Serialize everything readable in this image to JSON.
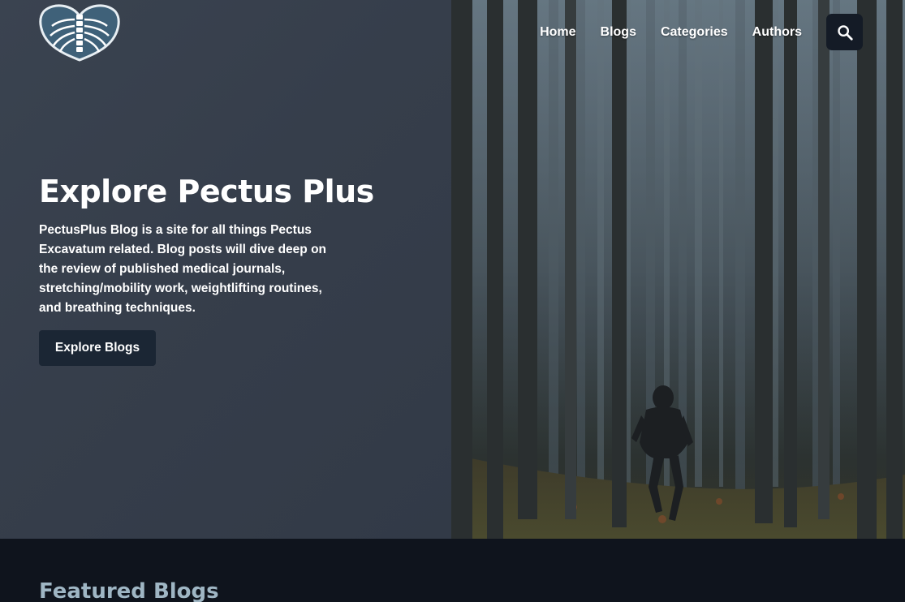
{
  "brand": {
    "logo_icon": "ribcage-heart-logo",
    "accent": "#9fb6c4"
  },
  "nav": {
    "items": [
      {
        "label": "Home"
      },
      {
        "label": "Blogs"
      },
      {
        "label": "Categories"
      },
      {
        "label": "Authors"
      }
    ],
    "search_icon": "search-icon"
  },
  "hero": {
    "title": "Explore Pectus Plus",
    "description": "PectusPlus Blog is a site for all things Pectus Excavatum related. Blog posts will dive deep on the review of published medical journals, stretching/mobility work, weightlifting routines, and breathing techniques.",
    "cta_label": "Explore Blogs",
    "image": "misty-forest-person-running"
  },
  "featured": {
    "title": "Featured Blogs"
  }
}
